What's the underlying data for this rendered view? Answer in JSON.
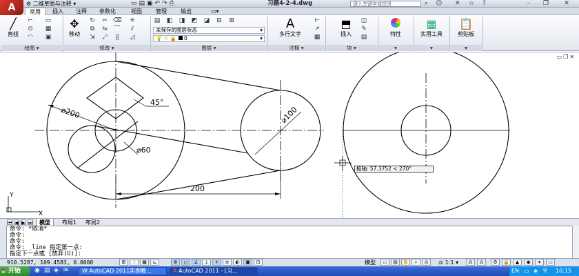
{
  "app": {
    "logo": "A",
    "workspace": "二维草图与注释",
    "document_title": "习题4-2-4.dwg",
    "search_placeholder": "键入关键字或短语",
    "qat_icons": [
      "new-icon",
      "open-icon",
      "save-icon",
      "undo-icon",
      "redo-icon",
      "print-icon"
    ]
  },
  "ribbon_tabs": [
    "常用",
    "插入",
    "注释",
    "参数化",
    "视图",
    "管理",
    "输出"
  ],
  "active_tab": "常用",
  "ribbon": {
    "draw": {
      "label": "绘图",
      "line_label": "直线"
    },
    "modify": {
      "label": "修改",
      "move_label": "移动"
    },
    "layers": {
      "label": "图层",
      "state_value": "未保存的图层状态",
      "current_layer": "0"
    },
    "annotation": {
      "label": "注释",
      "mtext_label": "多行文字",
      "mtext_icon": "A"
    },
    "block": {
      "label": "块",
      "insert_label": "插入"
    },
    "properties": {
      "label": "特性"
    },
    "utilities": {
      "label": "实用工具"
    },
    "clipboard": {
      "label": "剪贴板"
    }
  },
  "drawing": {
    "dim_diameter_200": "⌀200",
    "dim_diameter_100": "⌀100",
    "dim_diameter_60": "⌀60",
    "dim_angle": "45°",
    "dim_linear": "200",
    "tooltip": "极轴: 57.3752 < 270°",
    "ucs_y": "Y",
    "ucs_x": "X"
  },
  "layout_tabs": {
    "model": "模型",
    "layout1": "布局1",
    "layout2": "布局2"
  },
  "command_lines": [
    "命令: *取消*",
    "命令:",
    "命令:",
    "命令: _line 指定第一点:",
    "指定下一点或 [放弃(U)]:"
  ],
  "status": {
    "coordinates": "910.5287, 109.4583, 0.0000",
    "model_label": "模型",
    "scale": "1:1"
  },
  "taskbar": {
    "start": "开始",
    "tasks": [
      "AutoCAD 2011实例教...",
      "AutoCAD 2011 - [习..."
    ],
    "clock": "10:15"
  }
}
